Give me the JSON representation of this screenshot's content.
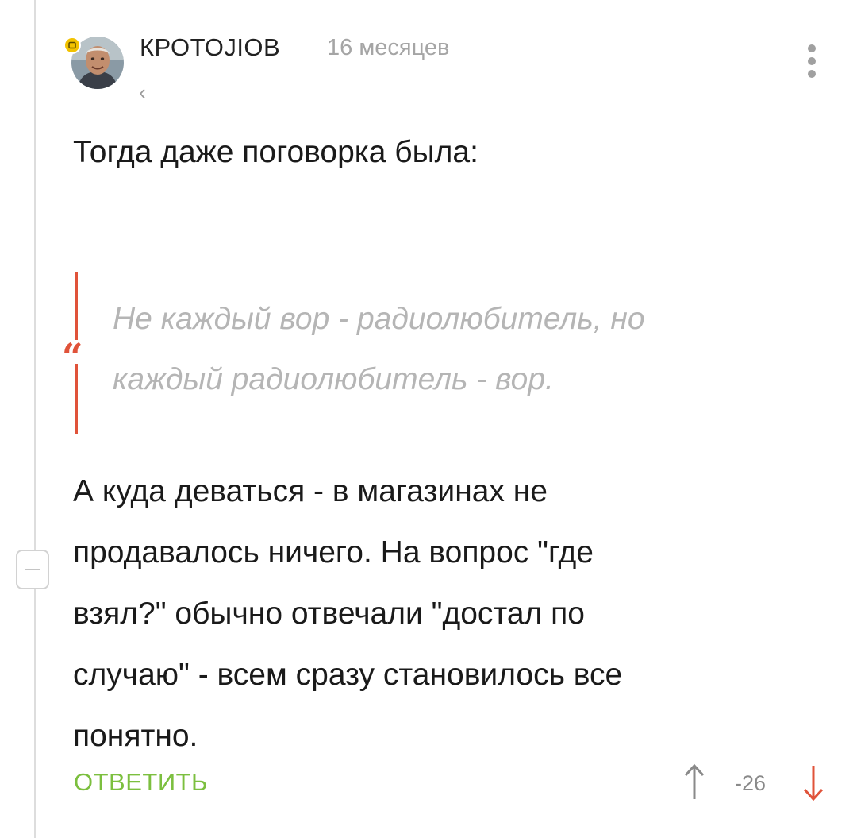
{
  "comment": {
    "author": "КРОТОJIОВ",
    "time": "16 месяцев",
    "back_symbol": "‹",
    "paragraph1": "Тогда даже поговорка была:",
    "quote": {
      "mark": "“",
      "lines": [
        "Не каждый вор - радиолюбитель, но",
        "каждый радиолюбитель - вор."
      ]
    },
    "paragraph2_lines": [
      "А куда деваться - в магазинах не",
      "продавалось ничего. На вопрос \"где",
      "взял?\" обычно отвечали \"достал по",
      "случаю\" - всем сразу становилось все",
      "понятно."
    ],
    "reply_label": "ОТВЕТИТЬ",
    "rating": "-26"
  },
  "icons": {
    "more": "more-vertical-icon",
    "upvote": "arrow-up-icon",
    "downvote": "arrow-down-icon",
    "badge": "badge-icon",
    "collapse": "minus-icon"
  },
  "colors": {
    "accent": "#e0533a",
    "reply": "#7cbf3f",
    "badge": "#f2c200",
    "quote_text": "#b5b5b5",
    "muted": "#a5a5a5"
  }
}
